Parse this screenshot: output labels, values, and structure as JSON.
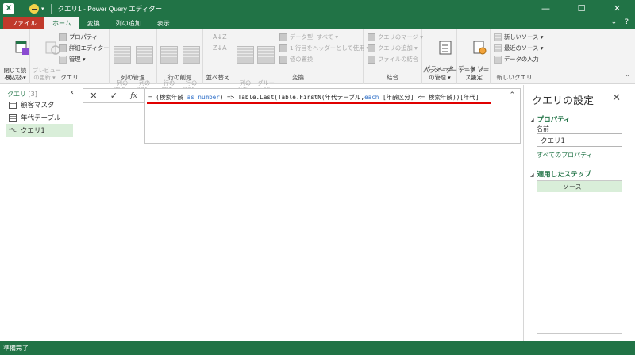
{
  "window": {
    "title": "クエリ1 - Power Query エディター",
    "logo": "X",
    "minimize_glyph": "—",
    "maximize_glyph": "☐",
    "close_glyph": "✕"
  },
  "tabs": [
    {
      "label": "ファイル"
    },
    {
      "label": "ホーム"
    },
    {
      "label": "変換"
    },
    {
      "label": "列の追加"
    },
    {
      "label": "表示"
    }
  ],
  "ribbon": {
    "close_group": {
      "label": "閉じる",
      "close_load": "閉じて読\nみ込む ▾"
    },
    "query_group": {
      "label": "クエリ",
      "preview_refresh": "プレビュー\nの更新 ▾",
      "properties": "プロパティ",
      "advanced_editor": "詳細エディター",
      "manage": "管理 ▾"
    },
    "manage_columns": {
      "label": "列の管理",
      "choose_columns": "列の\n選択 ▾",
      "remove_columns": "列の\n削除 ▾"
    },
    "reduce_rows": {
      "label": "行の削減",
      "keep_rows": "行の\n保持 ▾",
      "remove_rows": "行の\n削除 ▾"
    },
    "sort": {
      "label": "並べ替え"
    },
    "transform": {
      "label": "変換",
      "split_column": "列の\n分割 ▾",
      "group_by": "グルー\nプ化",
      "data_type": "データ型: すべて ▾",
      "first_row_header": "1 行目をヘッダーとして使用 ▾",
      "replace_values": "値の置換"
    },
    "combine": {
      "label": "結合",
      "merge_queries": "クエリのマージ ▾",
      "append_queries": "クエリの追加 ▾",
      "combine_files": "ファイルの結合"
    },
    "parameters": {
      "label": "パラメーター",
      "manage_parameters": "パラメーター\nの管理 ▾"
    },
    "data_sources": {
      "label": "データ ソース",
      "data_source_settings": "データ ソー\nス設定"
    },
    "new_query": {
      "label": "新しいクエリ",
      "new_source": "新しいソース ▾",
      "recent_sources": "最近のソース ▾",
      "enter_data": "データの入力"
    }
  },
  "queries_pane": {
    "header": "クエリ",
    "count": "[3]",
    "items": [
      {
        "label": "顧客マスタ"
      },
      {
        "label": "年代テーブル"
      },
      {
        "label": "クエリ1"
      }
    ]
  },
  "formula_bar": {
    "cancel": "✕",
    "commit": "✓",
    "fx": "fx",
    "seg1": "= (検索年齢 ",
    "kw1": "as number",
    "seg2": ") =>  Table.Last(Table.FirstN(年代テーブル,",
    "kw2": "each",
    "seg3": " [年齢区分] <= 検索年齢))[年代]"
  },
  "settings_pane": {
    "title": "クエリの設定",
    "properties_header": "プロパティ",
    "name_label": "名前",
    "name_value": "クエリ1",
    "all_properties": "すべてのプロパティ",
    "applied_steps_header": "適用したステップ",
    "steps": [
      {
        "label": "ソース"
      }
    ]
  },
  "status": {
    "text": "準備完了"
  },
  "colors": {
    "accent": "#217346",
    "selected": "#d9eed9",
    "underline": "#e00000"
  }
}
